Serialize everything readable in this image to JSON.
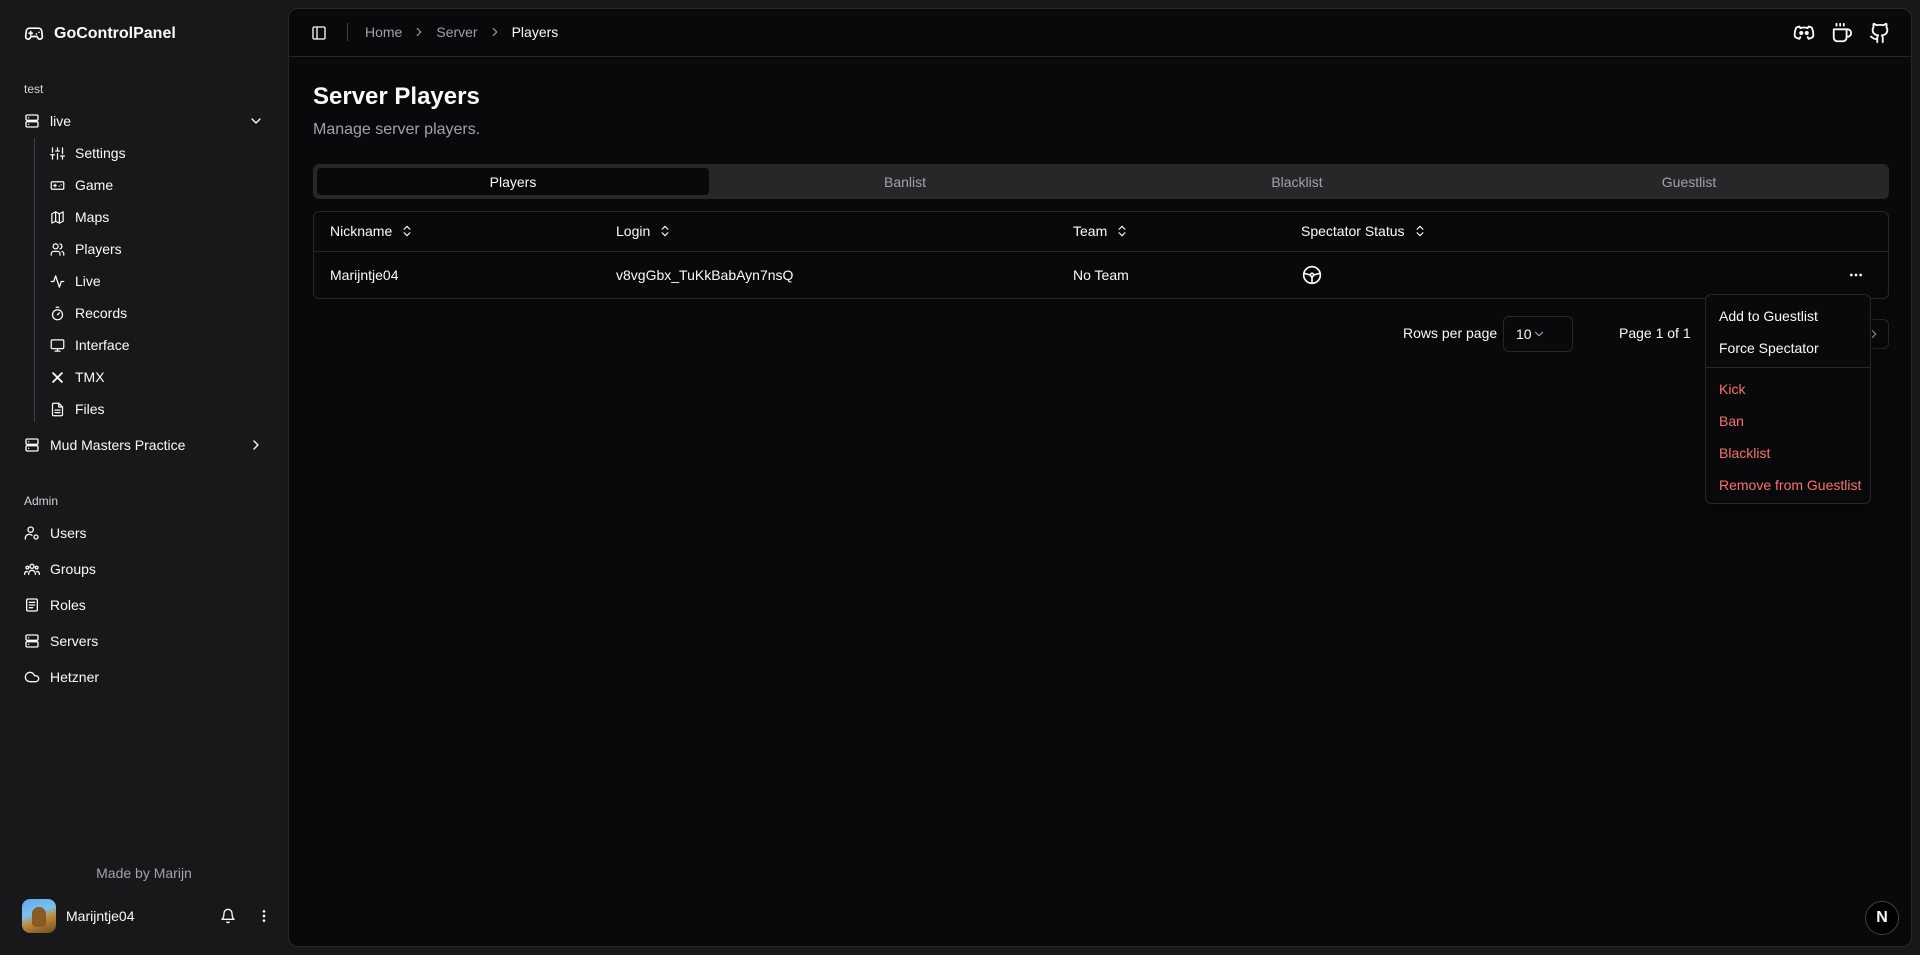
{
  "sidebar": {
    "brand": "GoControlPanel",
    "group_test": "test",
    "server_live": "live",
    "live_items": [
      {
        "label": "Settings",
        "icon": "sliders-icon"
      },
      {
        "label": "Game",
        "icon": "gamepad-icon"
      },
      {
        "label": "Maps",
        "icon": "map-icon"
      },
      {
        "label": "Players",
        "icon": "users-icon"
      },
      {
        "label": "Live",
        "icon": "activity-icon"
      },
      {
        "label": "Records",
        "icon": "timer-icon"
      },
      {
        "label": "Interface",
        "icon": "monitor-icon"
      },
      {
        "label": "TMX",
        "icon": "tmx-icon"
      },
      {
        "label": "Files",
        "icon": "file-icon"
      }
    ],
    "server_mud": "Mud Masters Practice",
    "group_admin": "Admin",
    "admin_items": [
      {
        "label": "Users",
        "icon": "user-cog-icon"
      },
      {
        "label": "Groups",
        "icon": "groups-icon"
      },
      {
        "label": "Roles",
        "icon": "roles-icon"
      },
      {
        "label": "Servers",
        "icon": "server-icon"
      },
      {
        "label": "Hetzner",
        "icon": "cloud-icon"
      }
    ],
    "made_by": "Made by Marijn",
    "user_name": "Marijntje04"
  },
  "header": {
    "breadcrumbs": [
      "Home",
      "Server",
      "Players"
    ]
  },
  "page": {
    "title": "Server Players",
    "subtitle": "Manage server players."
  },
  "tabs": [
    "Players",
    "Banlist",
    "Blacklist",
    "Guestlist"
  ],
  "table": {
    "columns": [
      "Nickname",
      "Login",
      "Team",
      "Spectator Status"
    ],
    "rows": [
      {
        "nickname": "Marijntje04",
        "login": "v8vgGbx_TuKkBabAyn7nsQ",
        "team": "No Team",
        "spectator_icon": "steering-wheel-icon"
      }
    ]
  },
  "pagination": {
    "rows_per_page_label": "Rows per page",
    "rows_per_page_value": "10",
    "page_label": "Page 1 of 1"
  },
  "row_menu": {
    "items": [
      "Add to Guestlist",
      "Force Spectator"
    ],
    "danger_items": [
      "Kick",
      "Ban",
      "Blacklist",
      "Remove from Guestlist"
    ]
  },
  "badge": "N",
  "colors": {
    "background": "#09090b",
    "sidebar": "#18181b",
    "danger": "#f87171",
    "muted": "#a1a1aa"
  }
}
